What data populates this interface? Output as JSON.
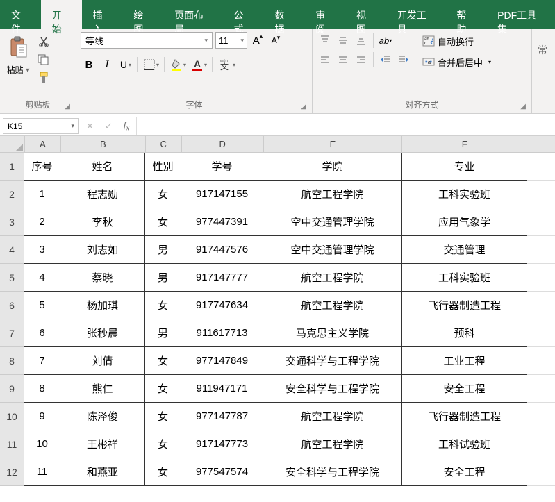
{
  "tabs": {
    "file": "文件",
    "home": "开始",
    "insert": "插入",
    "draw": "绘图",
    "layout": "页面布局",
    "formula": "公式",
    "data": "数据",
    "review": "审阅",
    "view": "视图",
    "dev": "开发工具",
    "help": "帮助",
    "pdf": "PDF工具集"
  },
  "clipboard": {
    "paste": "粘贴",
    "label": "剪贴板"
  },
  "font": {
    "name": "等线",
    "size": "11",
    "label": "字体"
  },
  "align": {
    "wrap": "自动换行",
    "merge": "合并后居中",
    "label": "对齐方式"
  },
  "namebox": "K15",
  "colHeaders": [
    "A",
    "B",
    "C",
    "D",
    "E",
    "F"
  ],
  "headerRow": [
    "序号",
    "姓名",
    "性别",
    "学号",
    "学院",
    "专业"
  ],
  "rows": [
    [
      "1",
      "程志勋",
      "女",
      "917147155",
      "航空工程学院",
      "工科实验班"
    ],
    [
      "2",
      "李秋",
      "女",
      "977447391",
      "空中交通管理学院",
      "应用气象学"
    ],
    [
      "3",
      "刘志如",
      "男",
      "917447576",
      "空中交通管理学院",
      "交通管理"
    ],
    [
      "4",
      "蔡晓",
      "男",
      "917147777",
      "航空工程学院",
      "工科实验班"
    ],
    [
      "5",
      "杨加琪",
      "女",
      "917747634",
      "航空工程学院",
      "飞行器制造工程"
    ],
    [
      "6",
      "张秒晨",
      "男",
      "911617713",
      "马克思主义学院",
      "预科"
    ],
    [
      "7",
      "刘倩",
      "女",
      "977147849",
      "交通科学与工程学院",
      "工业工程"
    ],
    [
      "8",
      "熊仁",
      "女",
      "911947171",
      "安全科学与工程学院",
      "安全工程"
    ],
    [
      "9",
      "陈泽俊",
      "女",
      "977147787",
      "航空工程学院",
      "飞行器制造工程"
    ],
    [
      "10",
      "王彬祥",
      "女",
      "917147773",
      "航空工程学院",
      "工科试验班"
    ],
    [
      "11",
      "和燕亚",
      "女",
      "977547574",
      "安全科学与工程学院",
      "安全工程"
    ]
  ]
}
